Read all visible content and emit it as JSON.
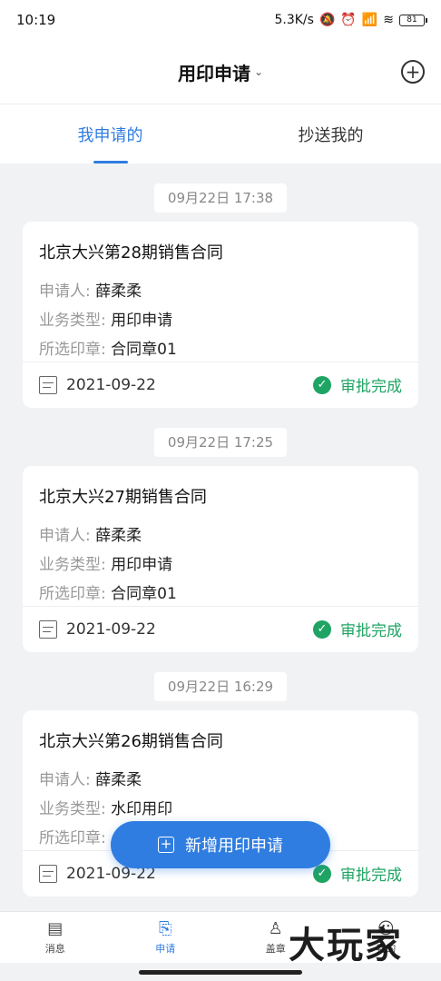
{
  "status_bar": {
    "time": "10:19",
    "speed": "5.3K/s",
    "battery": "81"
  },
  "header": {
    "title": "用印申请",
    "title_chevron": "⌄",
    "add_icon": "plus-circle-icon"
  },
  "tabs": [
    {
      "label": "我申请的",
      "active": true
    },
    {
      "label": "抄送我的",
      "active": false
    }
  ],
  "labels": {
    "applicant": "申请人:",
    "business_type": "业务类型:",
    "selected_seal": "所选印章:"
  },
  "records": [
    {
      "time": "09月22日 17:38",
      "title": "北京大兴第28期销售合同",
      "applicant": "薛柔柔",
      "business_type": "用印申请",
      "seal": "合同章01",
      "date": "2021-09-22",
      "status": "审批完成"
    },
    {
      "time": "09月22日 17:25",
      "title": "北京大兴27期销售合同",
      "applicant": "薛柔柔",
      "business_type": "用印申请",
      "seal": "合同章01",
      "date": "2021-09-22",
      "status": "审批完成"
    },
    {
      "time": "09月22日 16:29",
      "title": "北京大兴第26期销售合同",
      "applicant": "薛柔柔",
      "business_type": "水印用印",
      "seal": "",
      "date": "2021-09-22",
      "status": "审批完成"
    }
  ],
  "fab": {
    "label": "新增用印申请"
  },
  "bottom_nav": [
    {
      "label": "消息",
      "icon": "message-icon",
      "active": false
    },
    {
      "label": "申请",
      "icon": "apply-icon",
      "active": true
    },
    {
      "label": "盖章",
      "icon": "stamp-icon",
      "active": false
    },
    {
      "label": "我的",
      "icon": "profile-icon",
      "active": false
    }
  ],
  "watermark": "大玩家",
  "colors": {
    "accent": "#2f7de1",
    "success": "#1fa463",
    "background": "#f1f2f4"
  }
}
